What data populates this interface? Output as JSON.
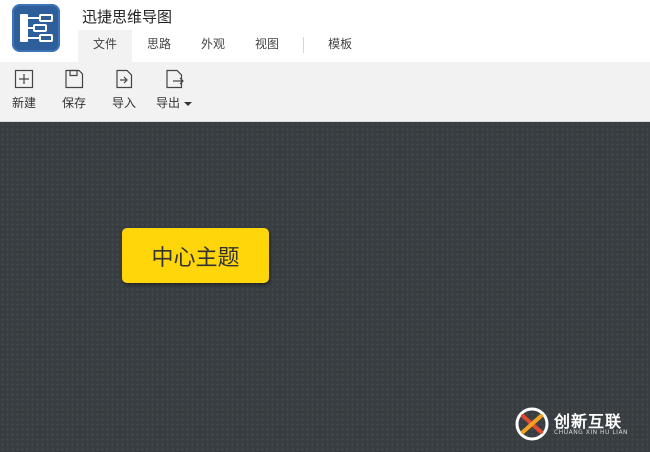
{
  "app": {
    "title": "迅捷思维导图",
    "logo_icon": "mindmap-logo-icon",
    "logo_color": "#2e5f9c"
  },
  "tabs": [
    {
      "label": "文件",
      "active": true
    },
    {
      "label": "思路",
      "active": false
    },
    {
      "label": "外观",
      "active": false
    },
    {
      "label": "视图",
      "active": false
    },
    {
      "label": "模板",
      "active": false
    }
  ],
  "toolbar": {
    "new": {
      "label": "新建",
      "icon": "new-file-icon"
    },
    "save": {
      "label": "保存",
      "icon": "save-icon"
    },
    "import": {
      "label": "导入",
      "icon": "import-icon"
    },
    "export": {
      "label": "导出",
      "icon": "export-icon"
    }
  },
  "canvas": {
    "background": "#373d40",
    "central_topic": {
      "text": "中心主题",
      "color": "#ffd60a"
    }
  },
  "watermark": {
    "text": "创新互联",
    "subtext": "CHUANG XIN HU LIAN",
    "logo_colors": [
      "#e24b2e",
      "#f4a020",
      "#ffffff"
    ]
  }
}
